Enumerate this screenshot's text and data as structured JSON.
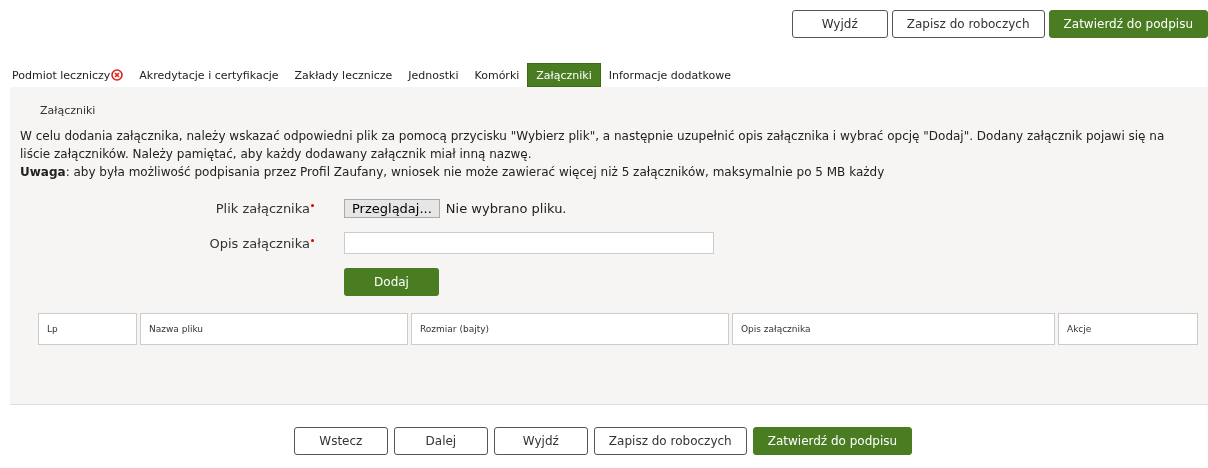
{
  "top_actions": [
    {
      "label": "Wyjdź",
      "kind": "default"
    },
    {
      "label": "Zapisz do roboczych",
      "kind": "default"
    },
    {
      "label": "Zatwierdź do podpisu",
      "kind": "primary"
    }
  ],
  "tabs": [
    {
      "label": "Podmiot leczniczy",
      "selected": false,
      "error": true
    },
    {
      "label": "Akredytacje i certyfikacje",
      "selected": false,
      "error": false
    },
    {
      "label": "Zakłady lecznicze",
      "selected": false,
      "error": false
    },
    {
      "label": "Jednostki",
      "selected": false,
      "error": false
    },
    {
      "label": "Komórki",
      "selected": false,
      "error": false
    },
    {
      "label": "Załączniki",
      "selected": true,
      "error": false
    },
    {
      "label": "Informacje dodatkowe",
      "selected": false,
      "error": false
    }
  ],
  "section_title": "Załączniki",
  "instructions": [
    "W celu dodania załącznika, należy wskazać odpowiedni plik za pomocą przycisku \"Wybierz plik\", a następnie uzupełnić opis załącznika i wybrać opcję \"Dodaj\". Dodany załącznik pojawi się na liście załączników. Należy pamiętać, aby każdy dodawany załącznik miał inną nazwę.",
    "**Uwaga**: aby była możliwość podpisania przez Profil Zaufany, wniosek nie może zawierać więcej niż 5 załączników, maksymalnie po 5 MB każdy"
  ],
  "form": [
    {
      "label": "Plik załącznika",
      "required": true,
      "kind": "file",
      "button": "Przeglądaj...",
      "status": "Nie wybrano pliku."
    },
    {
      "label": "Opis załącznika",
      "required": true,
      "kind": "text"
    }
  ],
  "add_button": "Dodaj",
  "table": {
    "columns": [
      "Lp",
      "Nazwa pliku",
      "Rozmiar (bajty)",
      "Opis załącznika",
      "Akcje"
    ]
  },
  "bottom_actions": [
    {
      "label": "Wstecz",
      "kind": "default"
    },
    {
      "label": "Dalej",
      "kind": "default"
    },
    {
      "label": "Wyjdź",
      "kind": "default"
    },
    {
      "label": "Zapisz do roboczych",
      "kind": "default"
    },
    {
      "label": "Zatwierdź do podpisu",
      "kind": "primary"
    }
  ]
}
